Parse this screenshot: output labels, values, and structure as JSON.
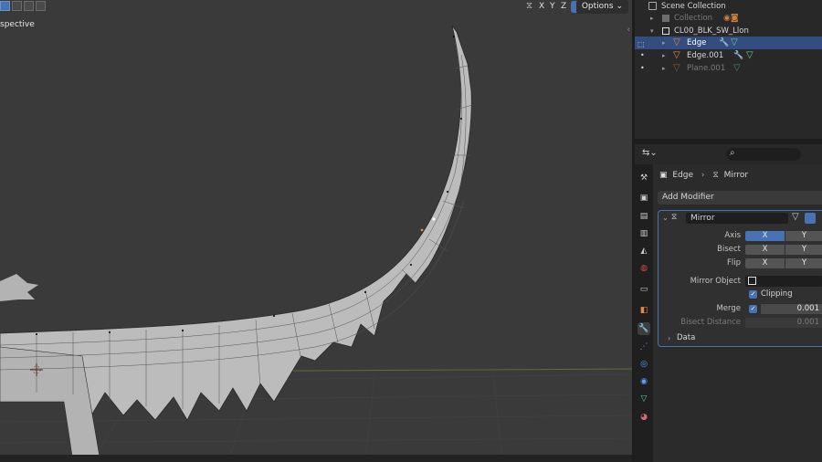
{
  "viewport": {
    "title": "spective",
    "axis_buttons": [
      "X",
      "Y",
      "Z"
    ],
    "options_label": "Options",
    "options_chevron": "chevron-down-icon"
  },
  "outliner": {
    "scene_collection": "Scene Collection",
    "items": [
      {
        "label": "Collection",
        "dimmed": true
      },
      {
        "label": "CL00_BLK_SW_Llon",
        "dimmed": false
      },
      {
        "label": "Edge",
        "dimmed": false,
        "selected": true
      },
      {
        "label": "Edge.001",
        "dimmed": false
      },
      {
        "label": "Plane.001",
        "dimmed": true
      }
    ]
  },
  "properties": {
    "breadcrumb": {
      "object": "Edge",
      "modifier": "Mirror"
    },
    "add_modifier_label": "Add Modifier",
    "modifier": {
      "name": "Mirror",
      "axis": {
        "label": "Axis",
        "x": "X",
        "y": "Y",
        "x_on": true
      },
      "bisect": {
        "label": "Bisect",
        "x": "X",
        "y": "Y"
      },
      "flip": {
        "label": "Flip",
        "x": "X",
        "y": "Y"
      },
      "mirror_object_label": "Mirror Object",
      "clipping_label": "Clipping",
      "merge_label": "Merge",
      "merge_value": "0.001",
      "bisect_distance_label": "Bisect Distance",
      "bisect_distance_value": "0.001",
      "data_label": "Data"
    }
  },
  "colors": {
    "accent": "#4772b3",
    "selected_row": "#334d80",
    "edit_orange": "#e08a3c"
  }
}
